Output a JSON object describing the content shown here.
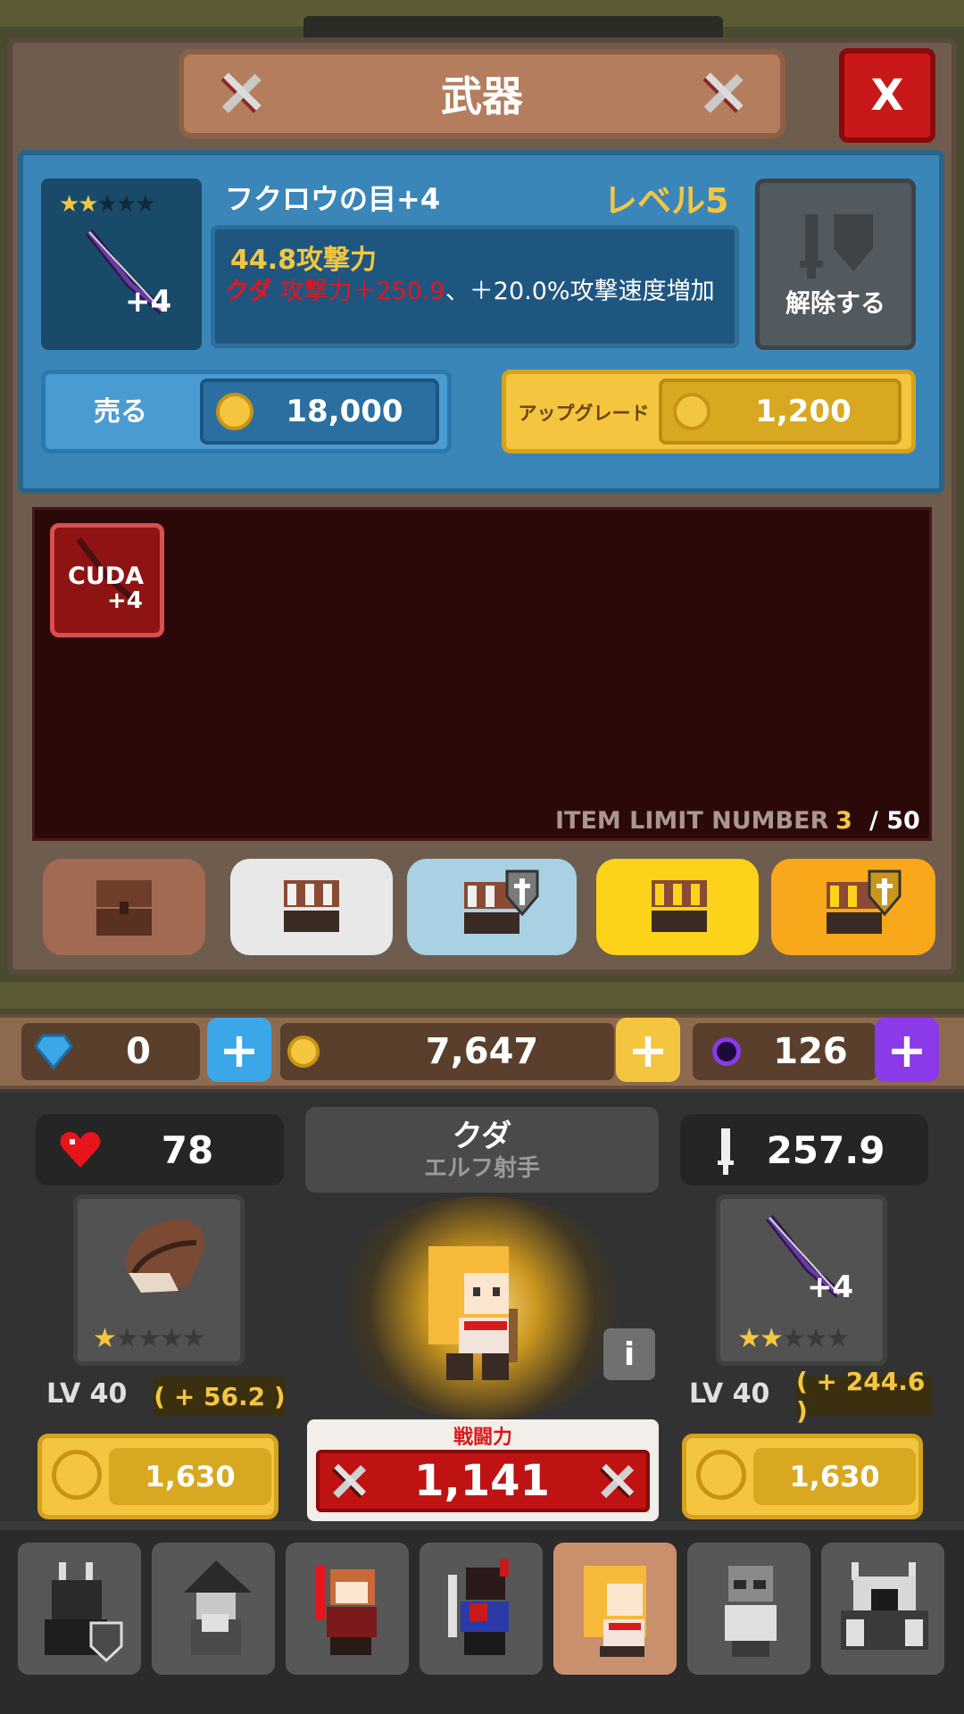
{
  "window": {
    "title": "武器",
    "close_label": "X"
  },
  "weapon": {
    "stars_filled": 2,
    "stars_total": 5,
    "name": "フクロウの目+4",
    "level_label": "レベル5",
    "icon_badge": "+4",
    "attack": "44.8攻撃力",
    "bonus_owner": "クダ",
    "bonus_attack": "攻撃力＋250.9",
    "bonus_speed": "、＋20.0%攻撃速度増加",
    "unequip_label": "解除する",
    "sell_label": "売る",
    "sell_price": "18,000",
    "upgrade_label": "アップグレード",
    "upgrade_price": "1,200"
  },
  "inventory": {
    "items": [
      {
        "name": "CUDA",
        "badge": "+4"
      }
    ],
    "limit_label": "ITEM LIMIT NUMBER",
    "limit_count": "3",
    "limit_max": "/ 50"
  },
  "tabs": [
    {
      "name": "brown-chest",
      "color": "#a26a52"
    },
    {
      "name": "white-chest",
      "color": "#e8e8e8"
    },
    {
      "name": "blue-chest-shield",
      "color": "#a8d2e4"
    },
    {
      "name": "yellow-chest",
      "color": "#fcd21a"
    },
    {
      "name": "orange-chest-shield",
      "color": "#f8a81a"
    }
  ],
  "currency": {
    "gems": "0",
    "coins": "7,647",
    "orbs": "126",
    "gem_color": "#3ba6e8",
    "coin_color": "#f4c640",
    "orb_color": "#8a3ae8"
  },
  "hero": {
    "hp": "78",
    "name": "クダ",
    "class": "エルフ射手",
    "attack": "257.9",
    "info_label": "i",
    "left_slot": {
      "stars_filled": 1,
      "level": "LV 40",
      "bonus": "( + 56.2 )",
      "price": "1,630"
    },
    "right_slot": {
      "stars_filled": 2,
      "level": "LV 40",
      "bonus": "( + 244.6 )",
      "price": "1,630",
      "badge": "+4"
    },
    "power_label": "戦闘力",
    "power_value": "1,141"
  },
  "characters": [
    {
      "name": "dark-knight",
      "selected": false
    },
    {
      "name": "wizard",
      "selected": false
    },
    {
      "name": "red-warrior",
      "selected": false
    },
    {
      "name": "horned-warrior",
      "selected": false
    },
    {
      "name": "elf-archer",
      "selected": true
    },
    {
      "name": "scientist",
      "selected": false
    },
    {
      "name": "robot-boss",
      "selected": false
    }
  ]
}
